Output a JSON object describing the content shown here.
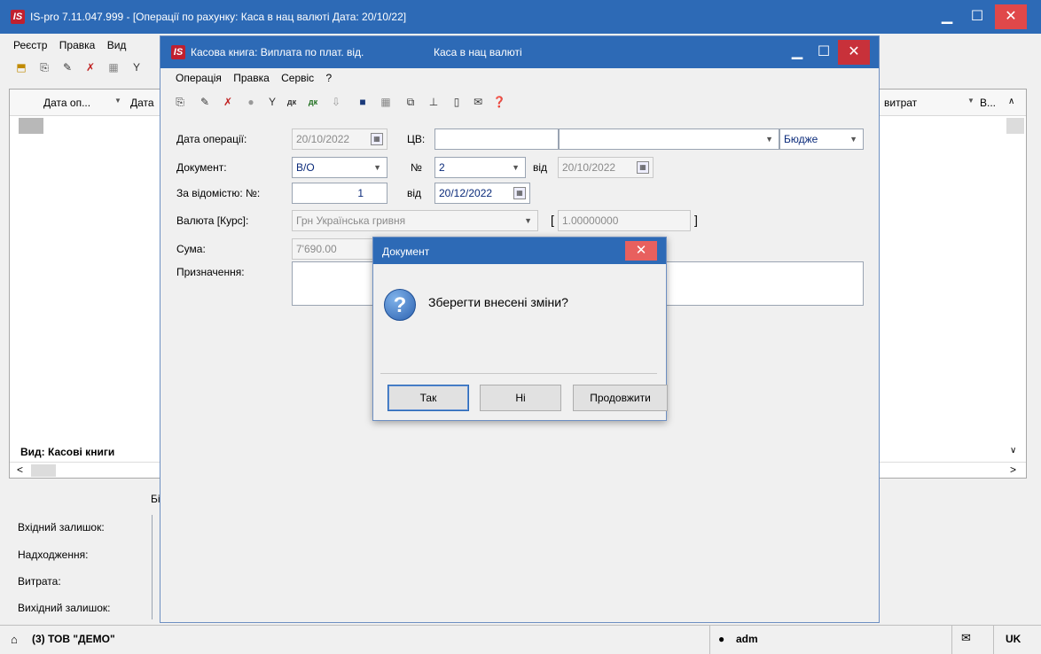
{
  "main": {
    "logo": "IS",
    "title": "IS-pro 7.11.047.999 - [Операції по рахунку: Каса в нац валюті     Дата: 20/10/22]",
    "menu": [
      "Реєстр",
      "Правка",
      "Вид"
    ],
    "grid": {
      "columns": [
        "Дата оп...",
        "Дата",
        "витрат",
        "В..."
      ],
      "footer_view": "Вид: Касові книги"
    },
    "summary": {
      "col_header_partial": "Бі",
      "rows": [
        "Вхідний залишок:",
        "Надходження:",
        "Витрата:",
        "Вихідний залишок:"
      ]
    },
    "status": {
      "org": "(3) ТОВ \"ДЕМО\"",
      "user": "adm",
      "lang": "UK"
    }
  },
  "child": {
    "logo": "IS",
    "title": "Касова книга: Виплата по плат. від.",
    "title_right": "Каса в нац валюті",
    "menu": [
      "Операція",
      "Правка",
      "Сервіс",
      "?"
    ],
    "form": {
      "date_label": "Дата операції:",
      "date_value": "20/10/2022",
      "cv_label": "ЦВ:",
      "budget_value": "Бюдже",
      "doc_label": "Документ:",
      "doc_value": "В/О",
      "num_label": "№",
      "num_value": "2",
      "from_label": "від",
      "from_value": "20/10/2022",
      "statement_label": "За відомістю: №:",
      "statement_value": "1",
      "statement_from_label": "від",
      "statement_from_value": "20/12/2022",
      "currency_label": "Валюта [Курс]:",
      "currency_value": "Грн Українська гривня",
      "rate_open": "[",
      "rate_value": "1.00000000",
      "rate_close": "]",
      "sum_label": "Сума:",
      "sum_value": "7'690.00",
      "purpose_label": "Призначення:"
    }
  },
  "dialog": {
    "title": "Документ",
    "message": "Зберегти внесені зміни?",
    "buttons": {
      "yes": "Так",
      "no": "Ні",
      "continue": "Продовжити"
    }
  }
}
